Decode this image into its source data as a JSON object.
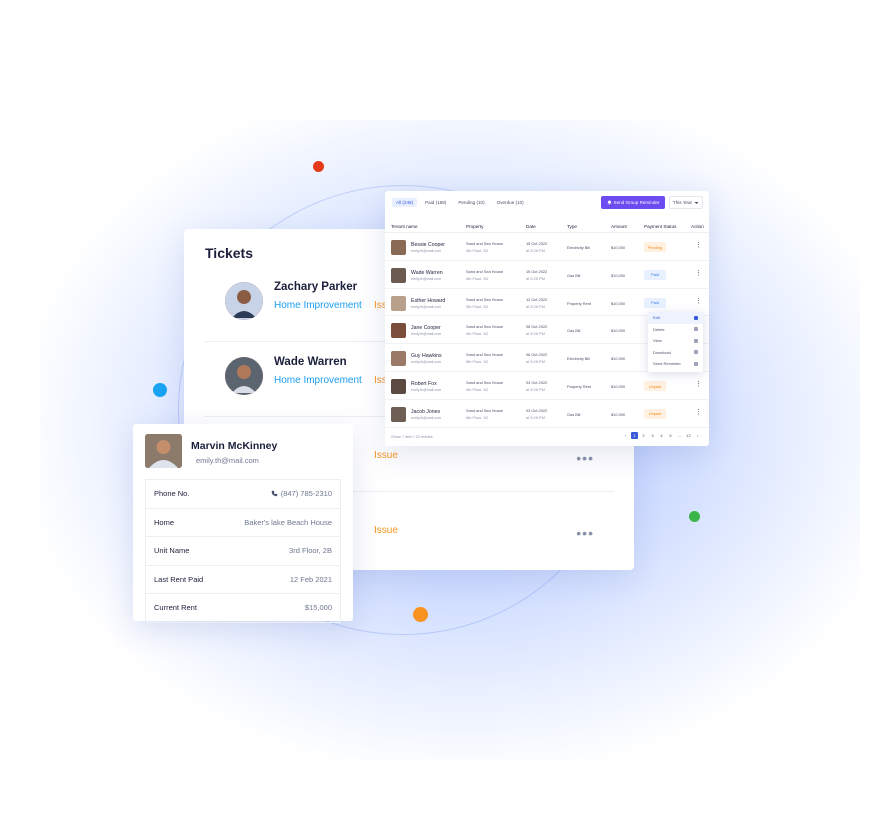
{
  "tickets": {
    "title": "Tickets",
    "items": [
      {
        "name": "Zachary Parker",
        "category": "Home Improvement",
        "tag": "Issue"
      },
      {
        "name": "Wade Warren",
        "category": "Home Improvement",
        "tag": "Issue"
      },
      {
        "name": "",
        "category": "",
        "tag": "Issue"
      },
      {
        "name": "",
        "category": "",
        "tag": "Issue"
      }
    ],
    "more_icon": "ellipsis-icon"
  },
  "tenant": {
    "name": "Marvin McKinney",
    "email": "emily.th@mail.com",
    "rows": [
      {
        "label": "Phone No.",
        "value": "(847) 785-2310",
        "icon": "phone-icon"
      },
      {
        "label": "Home",
        "value": "Baker's lake Beach House"
      },
      {
        "label": "Unit Name",
        "value": "3rd Floor, 2B"
      },
      {
        "label": "Last Rent Paid",
        "value": "12 Feb 2021"
      },
      {
        "label": "Current Rent",
        "value": "$15,000"
      }
    ]
  },
  "payments": {
    "tabs": [
      "All (248)",
      "Paid (188)",
      "Pending (10)",
      "Overdue (10)"
    ],
    "send_button": "Send Group Reminder",
    "filter": "This Year",
    "columns": [
      "Tenant name",
      "Property",
      "Date",
      "Type",
      "Amount",
      "Payment Status",
      "Action"
    ],
    "rows": [
      {
        "name": "Bessie Cooper",
        "email": "emily.th@mail.com",
        "property": "Sand and Sea House",
        "unit": "4th Floor, 3D",
        "date": "15 Oct 2022",
        "time": "at 5:25 PM",
        "type": "Electricity Bill",
        "amount": "$10,000",
        "status": "Pending"
      },
      {
        "name": "Wade Warren",
        "email": "emily.th@mail.com",
        "property": "Sand and Sea House",
        "unit": "4th Floor, 3D",
        "date": "15 Oct 2022",
        "time": "at 5:25 PM",
        "type": "Gas Bill",
        "amount": "$10,000",
        "status": "Paid"
      },
      {
        "name": "Esther Howard",
        "email": "emily.th@mail.com",
        "property": "Sand and Sea House",
        "unit": "3th Floor, 3D",
        "date": "12 Oct 2022",
        "time": "at 5:25 PM",
        "type": "Property Rent",
        "amount": "$10,000",
        "status": "Paid"
      },
      {
        "name": "Jane Cooper",
        "email": "emily.th@mail.com",
        "property": "Sand and Sea House",
        "unit": "4th Floor, 3D",
        "date": "08 Oct 2022",
        "time": "at 5:25 PM",
        "type": "Gas Bill",
        "amount": "$10,000",
        "status": ""
      },
      {
        "name": "Guy Hawkins",
        "email": "emily.th@mail.com",
        "property": "Sand and Sea House",
        "unit": "5th Floor, 3D",
        "date": "06 Oct 2022",
        "time": "at 5:25 PM",
        "type": "Electricity Bill",
        "amount": "$10,000",
        "status": ""
      },
      {
        "name": "Robert Fox",
        "email": "emily.th@mail.com",
        "property": "Sand and Sea House",
        "unit": "4th Floor, 3D",
        "date": "04 Oct 2022",
        "time": "at 5:25 PM",
        "type": "Property Rent",
        "amount": "$10,000",
        "status": "Unpaid"
      },
      {
        "name": "Jacob Jones",
        "email": "emily.th@mail.com",
        "property": "Sand and Sea House",
        "unit": "6th Floor, 3D",
        "date": "03 Oct 2022",
        "time": "at 5:25 PM",
        "type": "Gas Bill",
        "amount": "$10,000",
        "status": "Unpaid"
      }
    ],
    "footer": "Show 7 item / 22 entries",
    "pager": [
      "‹",
      "1",
      "2",
      "3",
      "4",
      "5",
      "...",
      "12",
      "›"
    ],
    "current_page": "1",
    "menu": [
      "Edit",
      "Delete",
      "View",
      "Download",
      "Send Reminder"
    ]
  },
  "colors": {
    "accent": "#6c4cf0",
    "link": "#1a9df0",
    "tag": "#f7931e"
  }
}
